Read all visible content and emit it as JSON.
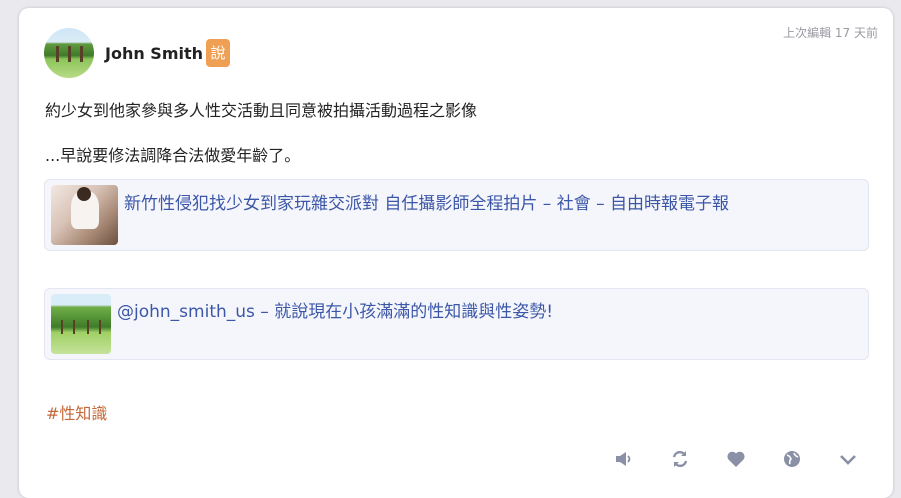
{
  "post": {
    "author": "John Smith",
    "badge": "說",
    "timestamp": "上次編輯 17 天前",
    "text_line1": "約少女到他家參與多人性交活動且同意被拍攝活動過程之影像",
    "text_line2": "...早說要修法調降合法做愛年齡了。",
    "hashtag": "#性知識"
  },
  "links": [
    {
      "title": "新竹性侵犯找少女到家玩雜交派對 自任攝影師全程拍片 – 社會 – 自由時報電子報"
    },
    {
      "title": "@john_smith_us – 就說現在小孩滿滿的性知識與性姿勢!"
    }
  ],
  "actions": {
    "icons": [
      "speaker-icon",
      "repeat-icon",
      "heart-icon",
      "globe-icon",
      "chevron-down-icon"
    ]
  },
  "colors": {
    "link": "#3c57a8",
    "hashtag": "#c4693a",
    "badge": "#f0a055",
    "icon": "#8a90a6"
  }
}
